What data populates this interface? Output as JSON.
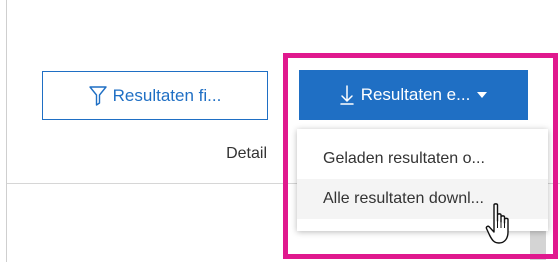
{
  "toolbar": {
    "filter_button": {
      "label": "Resultaten fi...",
      "icon": "filter-icon"
    },
    "export_button": {
      "label": "Resultaten e...",
      "icon": "download-arrow-icon",
      "caret_icon": "caret-down-icon"
    }
  },
  "table": {
    "column_header": "Detail"
  },
  "export_menu": {
    "items": [
      {
        "label": "Geladen resultaten o..."
      },
      {
        "label": "Alle resultaten downl..."
      }
    ],
    "hovered_item": 1
  },
  "colors": {
    "accent": "#1f6fc4",
    "highlight_border": "#e0198e",
    "menu_hover_bg": "#f4f4f4",
    "divider": "#d6d6d6"
  },
  "cursor": {
    "icon": "hand-pointer-icon"
  }
}
